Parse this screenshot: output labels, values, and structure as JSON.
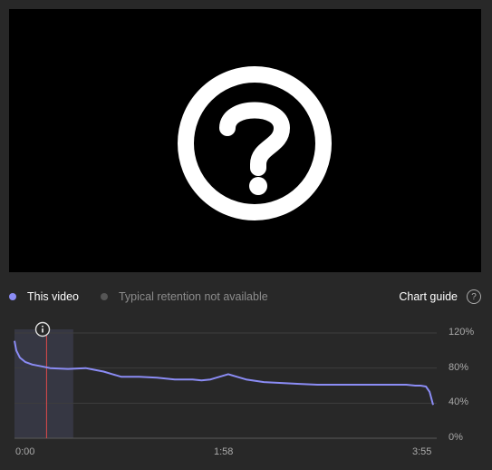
{
  "video": {
    "placeholder_icon": "question-circle-icon"
  },
  "legend": {
    "this_video": {
      "label": "This video",
      "color": "#8b8cf5"
    },
    "typical": {
      "label": "Typical retention not available",
      "color": "#555555"
    },
    "chart_guide": "Chart guide",
    "help_glyph": "?"
  },
  "chart_data": {
    "type": "line",
    "x_tick_labels": [
      "0:00",
      "1:58",
      "3:55"
    ],
    "y_tick_labels": [
      "120%",
      "80%",
      "40%",
      "0%"
    ],
    "ylim": [
      0,
      120
    ],
    "xlim_seconds": [
      0,
      235
    ],
    "grid": true,
    "highlight_range_seconds": [
      0,
      33
    ],
    "marker_seconds": 18,
    "series": [
      {
        "color": "#8b8cf5",
        "x_seconds": [
          0,
          1,
          3,
          6,
          10,
          15,
          20,
          30,
          40,
          45,
          50,
          55,
          60,
          70,
          80,
          90,
          100,
          105,
          110,
          115,
          120,
          125,
          130,
          140,
          150,
          160,
          170,
          180,
          190,
          200,
          210,
          220,
          225,
          228,
          231,
          233,
          235
        ],
        "values": [
          111,
          100,
          92,
          87,
          84,
          82,
          80,
          79,
          80,
          78,
          76,
          73,
          70,
          70,
          69,
          67,
          67,
          66,
          67,
          70,
          73,
          70,
          67,
          64,
          63,
          62,
          61,
          61,
          61,
          61,
          61,
          61,
          60,
          60,
          59,
          53,
          38
        ]
      }
    ]
  }
}
